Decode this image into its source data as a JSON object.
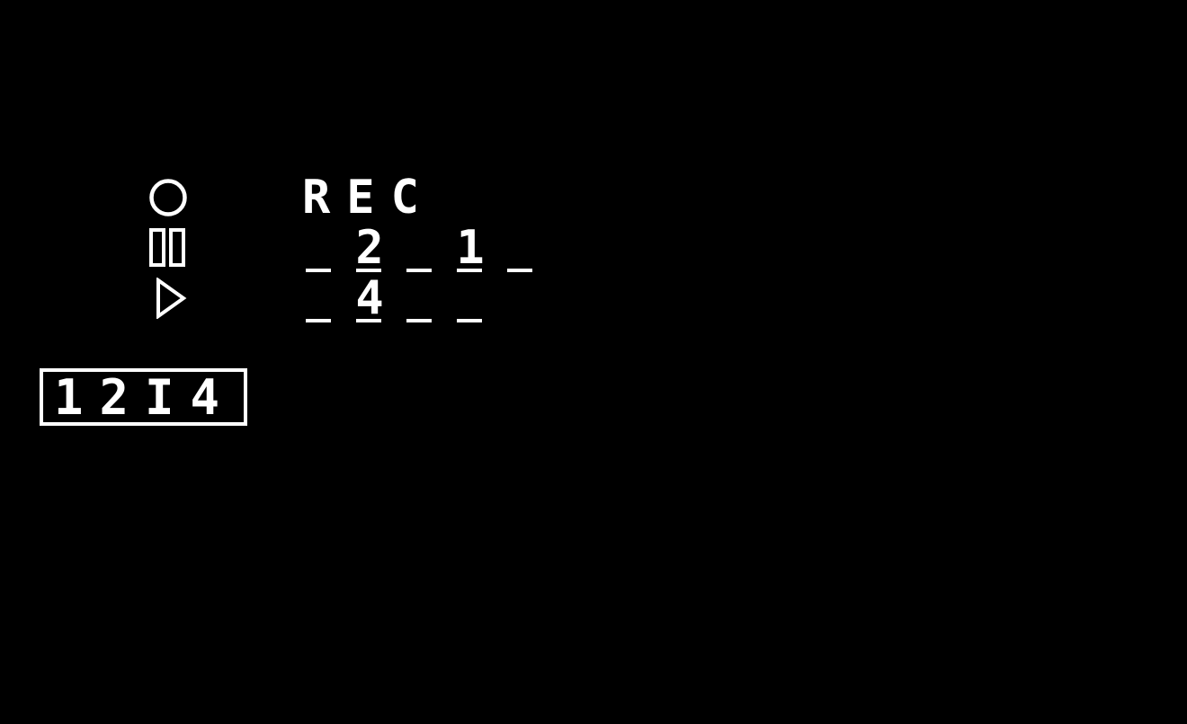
{
  "indicators": {
    "record_icon": "record-circle",
    "pause_icon": "pause-bars",
    "play_icon": "play-triangle"
  },
  "rec_label": "REC",
  "slots": {
    "row1": [
      "",
      "2",
      "",
      "1",
      ""
    ],
    "row2": [
      "",
      "4",
      "",
      ""
    ]
  },
  "code_display": "12I4",
  "colors": {
    "background": "#000000",
    "foreground": "#ffffff"
  }
}
